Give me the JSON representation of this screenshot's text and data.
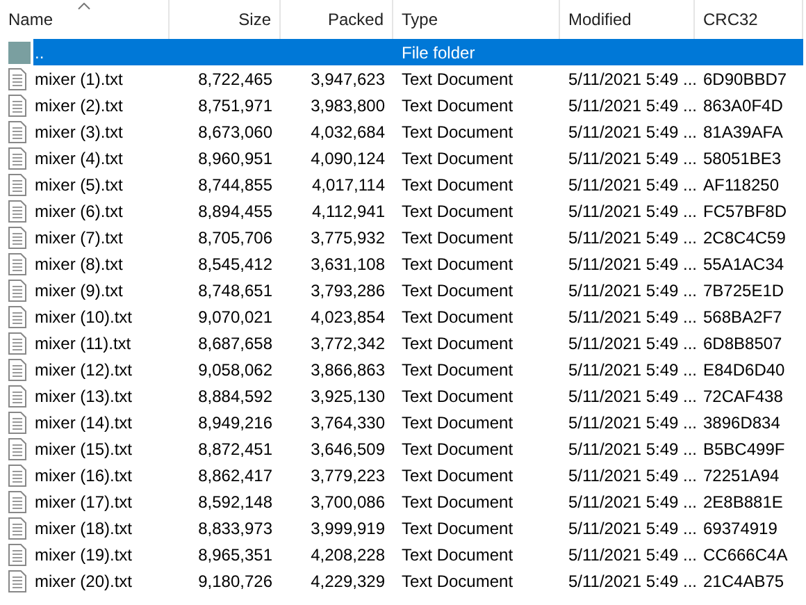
{
  "table": {
    "columns": [
      {
        "label": "Name",
        "sorted": true
      },
      {
        "label": "Size",
        "sorted": false
      },
      {
        "label": "Packed",
        "sorted": false
      },
      {
        "label": "Type",
        "sorted": false
      },
      {
        "label": "Modified",
        "sorted": false
      },
      {
        "label": "CRC32",
        "sorted": false
      }
    ],
    "rows": [
      {
        "kind": "folder",
        "selected": true,
        "cells": [
          "..",
          "",
          "",
          "File folder",
          "",
          ""
        ]
      },
      {
        "kind": "file",
        "selected": false,
        "cells": [
          "mixer (1).txt",
          "8,722,465",
          "3,947,623",
          "Text Document",
          "5/11/2021 5:49 ...",
          "6D90BBD7"
        ]
      },
      {
        "kind": "file",
        "selected": false,
        "cells": [
          "mixer (2).txt",
          "8,751,971",
          "3,983,800",
          "Text Document",
          "5/11/2021 5:49 ...",
          "863A0F4D"
        ]
      },
      {
        "kind": "file",
        "selected": false,
        "cells": [
          "mixer (3).txt",
          "8,673,060",
          "4,032,684",
          "Text Document",
          "5/11/2021 5:49 ...",
          "81A39AFA"
        ]
      },
      {
        "kind": "file",
        "selected": false,
        "cells": [
          "mixer (4).txt",
          "8,960,951",
          "4,090,124",
          "Text Document",
          "5/11/2021 5:49 ...",
          "58051BE3"
        ]
      },
      {
        "kind": "file",
        "selected": false,
        "cells": [
          "mixer (5).txt",
          "8,744,855",
          "4,017,114",
          "Text Document",
          "5/11/2021 5:49 ...",
          "AF118250"
        ]
      },
      {
        "kind": "file",
        "selected": false,
        "cells": [
          "mixer (6).txt",
          "8,894,455",
          "4,112,941",
          "Text Document",
          "5/11/2021 5:49 ...",
          "FC57BF8D"
        ]
      },
      {
        "kind": "file",
        "selected": false,
        "cells": [
          "mixer (7).txt",
          "8,705,706",
          "3,775,932",
          "Text Document",
          "5/11/2021 5:49 ...",
          "2C8C4C59"
        ]
      },
      {
        "kind": "file",
        "selected": false,
        "cells": [
          "mixer (8).txt",
          "8,545,412",
          "3,631,108",
          "Text Document",
          "5/11/2021 5:49 ...",
          "55A1AC34"
        ]
      },
      {
        "kind": "file",
        "selected": false,
        "cells": [
          "mixer (9).txt",
          "8,748,651",
          "3,793,286",
          "Text Document",
          "5/11/2021 5:49 ...",
          "7B725E1D"
        ]
      },
      {
        "kind": "file",
        "selected": false,
        "cells": [
          "mixer (10).txt",
          "9,070,021",
          "4,023,854",
          "Text Document",
          "5/11/2021 5:49 ...",
          "568BA2F7"
        ]
      },
      {
        "kind": "file",
        "selected": false,
        "cells": [
          "mixer (11).txt",
          "8,687,658",
          "3,772,342",
          "Text Document",
          "5/11/2021 5:49 ...",
          "6D8B8507"
        ]
      },
      {
        "kind": "file",
        "selected": false,
        "cells": [
          "mixer (12).txt",
          "9,058,062",
          "3,866,863",
          "Text Document",
          "5/11/2021 5:49 ...",
          "E84D6D40"
        ]
      },
      {
        "kind": "file",
        "selected": false,
        "cells": [
          "mixer (13).txt",
          "8,884,592",
          "3,925,130",
          "Text Document",
          "5/11/2021 5:49 ...",
          "72CAF438"
        ]
      },
      {
        "kind": "file",
        "selected": false,
        "cells": [
          "mixer (14).txt",
          "8,949,216",
          "3,764,330",
          "Text Document",
          "5/11/2021 5:49 ...",
          "3896D834"
        ]
      },
      {
        "kind": "file",
        "selected": false,
        "cells": [
          "mixer (15).txt",
          "8,872,451",
          "3,646,509",
          "Text Document",
          "5/11/2021 5:49 ...",
          "B5BC499F"
        ]
      },
      {
        "kind": "file",
        "selected": false,
        "cells": [
          "mixer (16).txt",
          "8,862,417",
          "3,779,223",
          "Text Document",
          "5/11/2021 5:49 ...",
          "72251A94"
        ]
      },
      {
        "kind": "file",
        "selected": false,
        "cells": [
          "mixer (17).txt",
          "8,592,148",
          "3,700,086",
          "Text Document",
          "5/11/2021 5:49 ...",
          "2E8B881E"
        ]
      },
      {
        "kind": "file",
        "selected": false,
        "cells": [
          "mixer (18).txt",
          "8,833,973",
          "3,999,919",
          "Text Document",
          "5/11/2021 5:49 ...",
          "69374919"
        ]
      },
      {
        "kind": "file",
        "selected": false,
        "cells": [
          "mixer (19).txt",
          "8,965,351",
          "4,208,228",
          "Text Document",
          "5/11/2021 5:49 ...",
          "CC666C4A"
        ]
      },
      {
        "kind": "file",
        "selected": false,
        "cells": [
          "mixer (20).txt",
          "9,180,726",
          "4,229,329",
          "Text Document",
          "5/11/2021 5:49 ...",
          "21C4AB75"
        ]
      }
    ]
  }
}
